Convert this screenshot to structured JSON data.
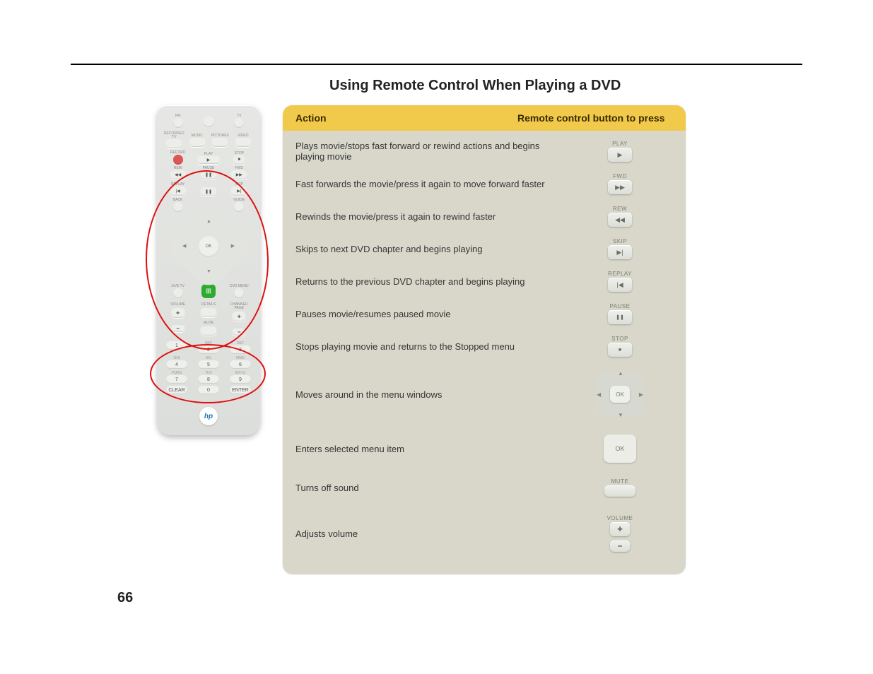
{
  "heading": "Using Remote Control When Playing a DVD",
  "table": {
    "header": {
      "action": "Action",
      "button": "Remote control button to press"
    },
    "rows": [
      {
        "action": "Plays movie/stops fast forward or rewind actions and begins playing movie",
        "label": "PLAY",
        "glyph": "▶"
      },
      {
        "action": "Fast forwards the movie/press it again to move forward faster",
        "label": "FWD",
        "glyph": "▶▶"
      },
      {
        "action": "Rewinds the movie/press it again to rewind faster",
        "label": "REW",
        "glyph": "◀◀"
      },
      {
        "action": "Skips to next DVD chapter and begins playing",
        "label": "SKIP",
        "glyph": "▶|"
      },
      {
        "action": "Returns to the previous DVD chapter and begins playing",
        "label": "REPLAY",
        "glyph": "|◀"
      },
      {
        "action": "Pauses movie/resumes paused movie",
        "label": "PAUSE",
        "glyph": "❚❚"
      },
      {
        "action": "Stops playing movie and returns to the Stopped menu",
        "label": "STOP",
        "glyph": "■"
      },
      {
        "action": "Moves around in the menu windows",
        "label": "",
        "glyph": "dpad"
      },
      {
        "action": "Enters selected menu item",
        "label": "",
        "glyph": "OK"
      },
      {
        "action": "Turns off sound",
        "label": "MUTE",
        "glyph": "mute"
      },
      {
        "action": "Adjusts volume",
        "label": "VOLUME",
        "glyph": "vol"
      }
    ]
  },
  "remote": {
    "row1": [
      "FM",
      "",
      "TV"
    ],
    "row1b": "●",
    "row2": [
      "RECORDED TV",
      "MUSIC",
      "PICTURES",
      "VIDEO"
    ],
    "row3": {
      "rec": "RECORD",
      "play": "PLAY",
      "stop": "STOP"
    },
    "row4": {
      "rew": "REW",
      "pause": "PAUSE",
      "fwd": "FWD"
    },
    "row5": {
      "replay": "REPLAY",
      "skip": "SKIP"
    },
    "row6": {
      "back": "BACK",
      "guide": "GUIDE"
    },
    "dpad_ok": "OK",
    "row7": {
      "l": "LIVE TV",
      "r": "DVD MENU"
    },
    "row8": {
      "vol": "VOLUME",
      "details": "DETAILS",
      "ch": "CHANNEL/\nPAGE",
      "mute": "MUTE"
    },
    "num_labels": [
      "",
      "ABC",
      "DEF",
      "GHI",
      "JKL",
      "MNO",
      "PQRS",
      "TUV",
      "WXYZ",
      "",
      "",
      ""
    ],
    "nums": [
      "1",
      "2",
      "3",
      "4",
      "5",
      "6",
      "7",
      "8",
      "9",
      "CLEAR",
      "0",
      "ENTER"
    ],
    "logo": "hp"
  },
  "page_number": "66"
}
